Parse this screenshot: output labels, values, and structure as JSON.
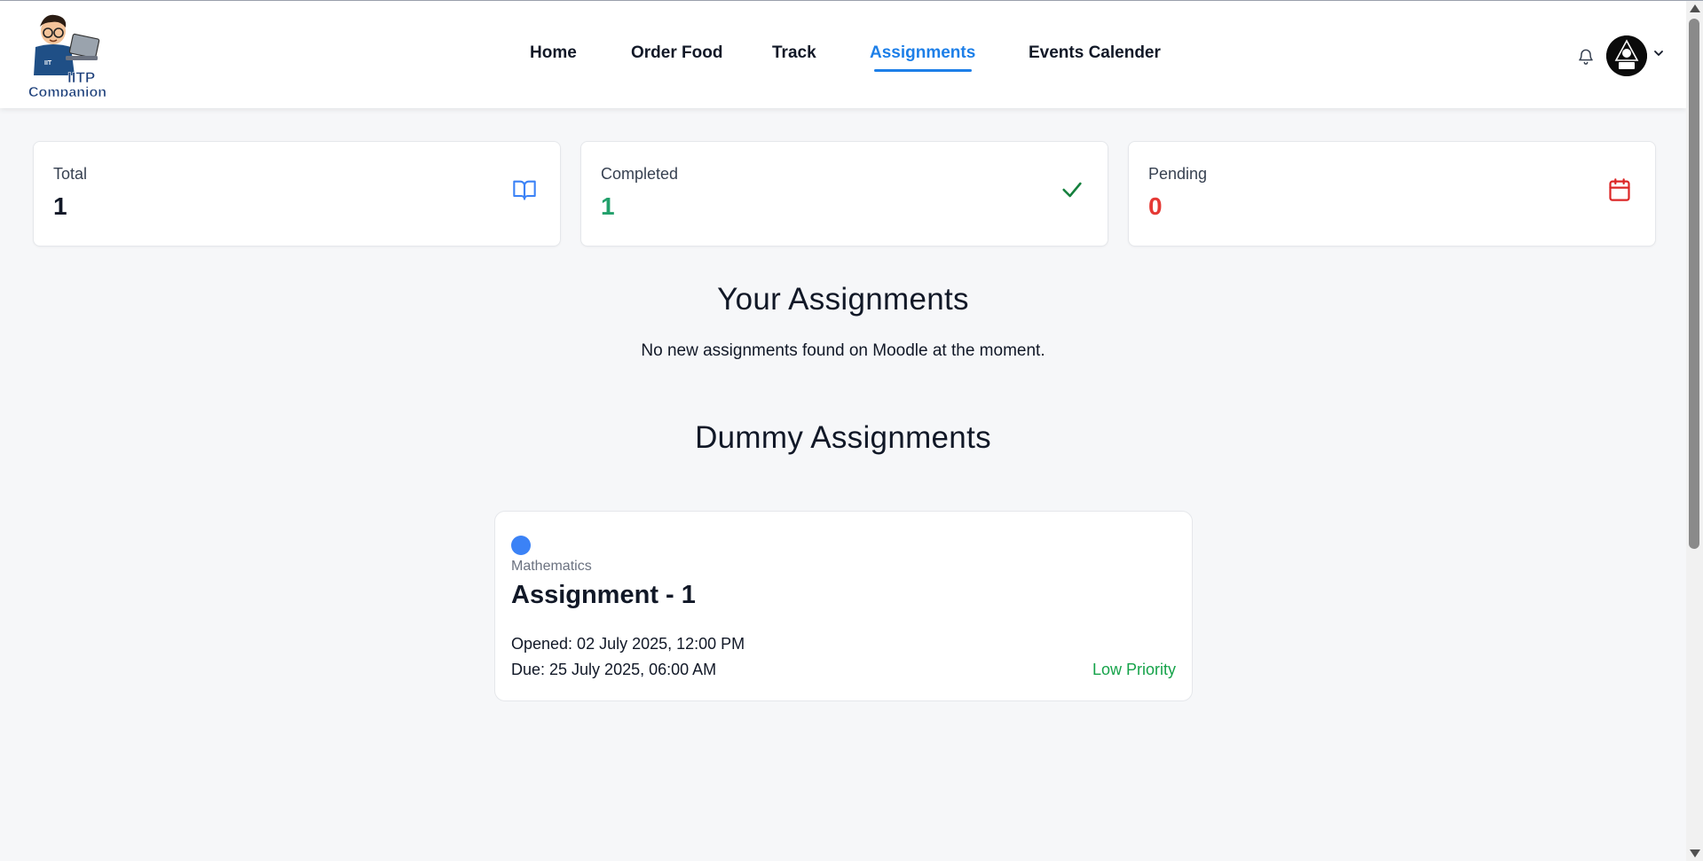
{
  "app": {
    "logo_icon": "iitp-companion-logo",
    "logo_text_line1": "IITP",
    "logo_text_line2": "Companion"
  },
  "nav": {
    "items": [
      {
        "label": "Home",
        "active": false
      },
      {
        "label": "Order Food",
        "active": false
      },
      {
        "label": "Track",
        "active": false
      },
      {
        "label": "Assignments",
        "active": true
      },
      {
        "label": "Events Calender",
        "active": false
      }
    ],
    "accent_color": "#1d7fe8"
  },
  "header_actions": {
    "notification_icon": "bell-icon",
    "avatar_icon": "user-avatar",
    "menu_icon": "chevron-down-icon"
  },
  "stats": [
    {
      "label": "Total",
      "value": "1",
      "icon": "book-open-icon",
      "color": "#111827",
      "icon_color": "#3b82f6"
    },
    {
      "label": "Completed",
      "value": "1",
      "icon": "check-icon",
      "color": "#22a06b",
      "icon_color": "#15803d"
    },
    {
      "label": "Pending",
      "value": "0",
      "icon": "calendar-icon",
      "color": "#e53935",
      "icon_color": "#dc2626"
    }
  ],
  "your_assignments": {
    "title": "Your Assignments",
    "message": "No new assignments found on Moodle at the moment."
  },
  "dummy_assignments": {
    "title": "Dummy Assignments",
    "items": [
      {
        "subject": "Mathematics",
        "title": "Assignment - 1",
        "opened": "Opened: 02 July 2025, 12:00 PM",
        "due": "Due: 25 July 2025, 06:00 AM",
        "priority": "Low Priority",
        "dot_color": "#3b82f6",
        "priority_color": "#16a34a"
      }
    ]
  }
}
